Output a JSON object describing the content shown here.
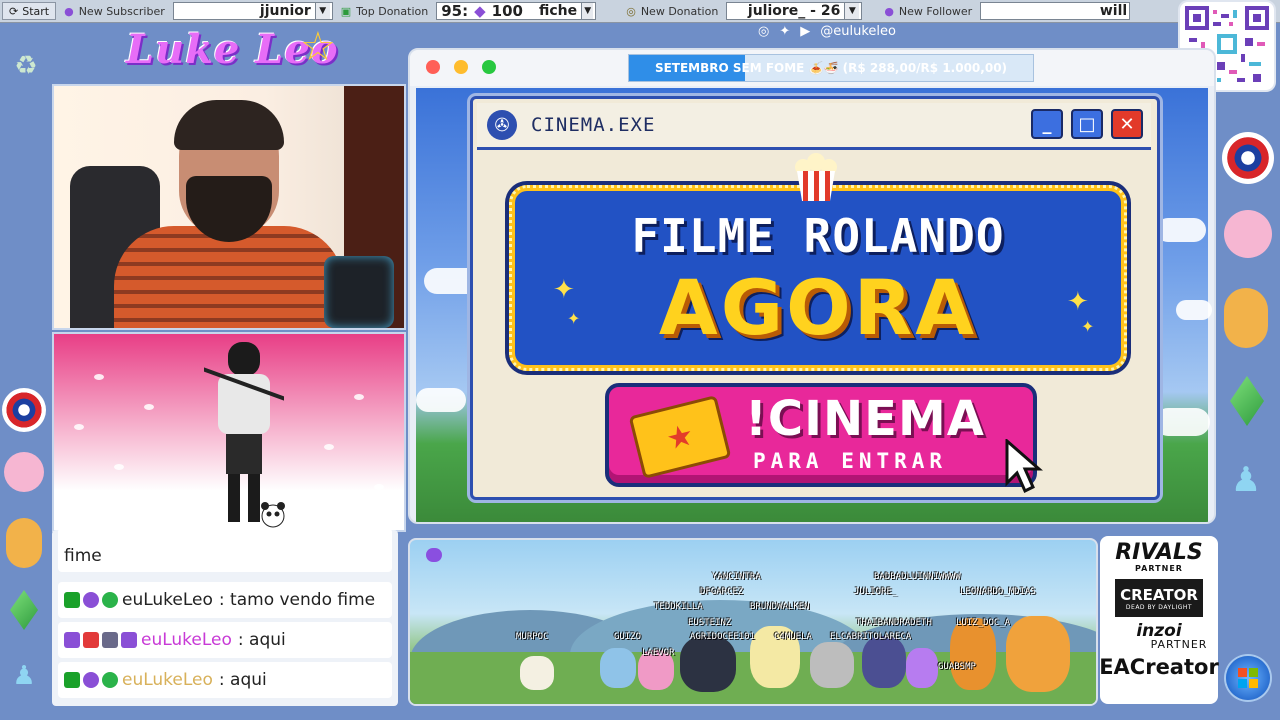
{
  "topbar": {
    "start_label": "Start",
    "subscriber_label": "New Subscriber",
    "subscriber_value": "jjunior",
    "donation_label": "Top Donation",
    "donation_prefix": "95:",
    "donation_amount": "100",
    "donation_value": "fiche",
    "new_donation_label": "New Donation",
    "new_donation_value": "juliore_ - 26",
    "follower_label": "New Follower",
    "follower_value": "will"
  },
  "logo": {
    "text": "Luke Leo"
  },
  "social": {
    "handle": "@eulukeleo"
  },
  "window": {
    "goal_text": "SETEMBRO SEM FOME 🍝🍜 (R$ 288,00/R$ 1.000,00)",
    "goal_progress": 0.288
  },
  "cinema": {
    "title": "CINEMA.EXE",
    "headline_top": "FILME ROLANDO",
    "headline_main": "AGORA",
    "command": "!CINEMA",
    "command_sub": "PARA ENTRAR",
    "minimize_label": "_",
    "maximize_label": "□",
    "close_label": "✕"
  },
  "chat": {
    "messages": [
      {
        "user": "",
        "text": "fime",
        "user_color": "#d8b15a"
      },
      {
        "user": "euLukeLeo",
        "text": ": tamo vendo fime",
        "user_color": "#222222"
      },
      {
        "user": "euLukeLeo",
        "text": ": aqui",
        "user_color": "#c83ad6"
      },
      {
        "user": "euLukeLeo",
        "text": ": aqui",
        "user_color": "#d8b15a"
      }
    ]
  },
  "community": {
    "names": [
      "YANCINTRA",
      "BADBADLUINNIWWWW",
      "DFGARCEZ",
      "JULIORE_",
      "LEONARDO_MDIAS",
      "TEDDKILLA",
      "BRUNDWALKEN",
      "EUSTEINZ",
      "THAIBANDRADETH",
      "LUIZ_DOC_A",
      "MURPOC",
      "GUIZO",
      "AGRIDOCEE101",
      "C4MUELA",
      "ELCABRITOLARECA",
      "LAEVOR",
      "GUABSMP"
    ]
  },
  "partner": {
    "rivals": "RIVALS",
    "rivals_sub": "PARTNER",
    "creator": "CREATOR",
    "creator_sub": "DEAD BY DAYLIGHT",
    "inzoi": "inzoi",
    "inzoi_sub": "PARTNER",
    "ea": "EACreator"
  }
}
